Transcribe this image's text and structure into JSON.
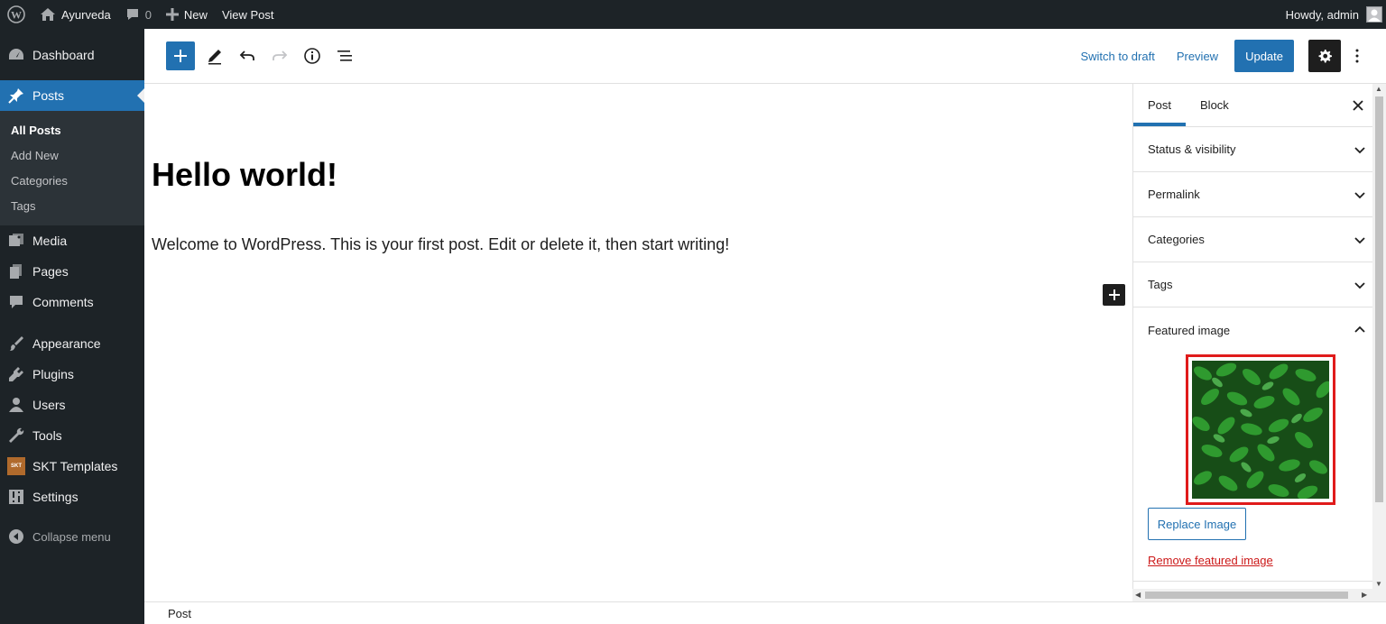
{
  "adminbar": {
    "site_name": "Ayurveda",
    "comments_count": "0",
    "new_label": "New",
    "view_post_label": "View Post",
    "howdy": "Howdy, admin"
  },
  "sidebar": {
    "items": [
      {
        "label": "Dashboard",
        "icon": "dashboard-icon"
      },
      {
        "label": "Posts",
        "icon": "pin-icon"
      },
      {
        "label": "Media",
        "icon": "media-icon"
      },
      {
        "label": "Pages",
        "icon": "pages-icon"
      },
      {
        "label": "Comments",
        "icon": "comment-icon"
      },
      {
        "label": "Appearance",
        "icon": "brush-icon"
      },
      {
        "label": "Plugins",
        "icon": "plugin-icon"
      },
      {
        "label": "Users",
        "icon": "user-icon"
      },
      {
        "label": "Tools",
        "icon": "wrench-icon"
      },
      {
        "label": "SKT Templates",
        "icon": "skt-logo-icon"
      },
      {
        "label": "Settings",
        "icon": "settings-sliders-icon"
      }
    ],
    "posts_submenu": [
      "All Posts",
      "Add New",
      "Categories",
      "Tags"
    ],
    "collapse_label": "Collapse menu"
  },
  "toolbar": {
    "switch_to_draft": "Switch to draft",
    "preview": "Preview",
    "update": "Update"
  },
  "post": {
    "title": "Hello world!",
    "paragraph": "Welcome to WordPress. This is your first post. Edit or delete it, then start writing!"
  },
  "settings": {
    "tabs": [
      "Post",
      "Block"
    ],
    "panels": [
      "Status & visibility",
      "Permalink",
      "Categories",
      "Tags"
    ],
    "featured_image": {
      "heading": "Featured image",
      "replace_label": "Replace Image",
      "remove_label": "Remove featured image"
    }
  },
  "footer": {
    "breadcrumb": "Post"
  },
  "colors": {
    "accent": "#2271b1",
    "admin_dark": "#1d2327",
    "highlight_border": "#e01b1b",
    "danger": "#cc1818"
  }
}
